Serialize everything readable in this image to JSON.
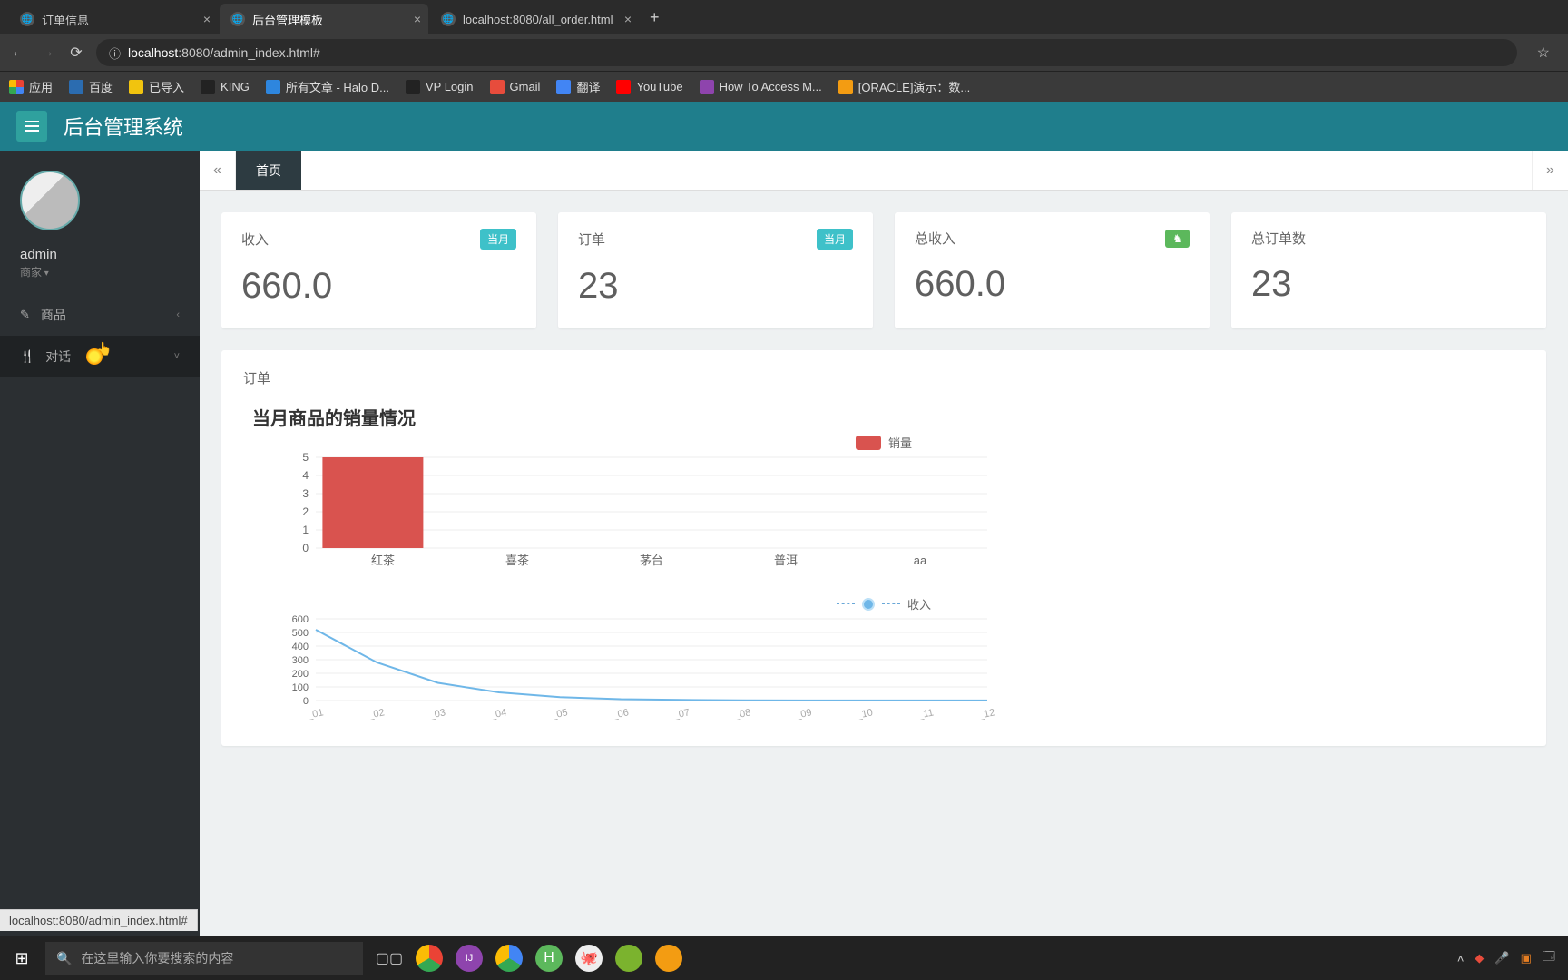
{
  "browser": {
    "tabs": [
      {
        "title": "订单信息"
      },
      {
        "title": "后台管理模板"
      },
      {
        "title": "localhost:8080/all_order.html"
      }
    ],
    "url_prefix": "localhost",
    "url_suffix": ":8080/admin_index.html#",
    "bookmarks": [
      {
        "label": "应用",
        "color": "#e74c3c"
      },
      {
        "label": "百度",
        "color": "#2b6cb0"
      },
      {
        "label": "已导入",
        "color": "#f1c40f"
      },
      {
        "label": "KING",
        "color": "#222"
      },
      {
        "label": "所有文章 - Halo D...",
        "color": "#2e86de"
      },
      {
        "label": "VP Login",
        "color": "#222"
      },
      {
        "label": "Gmail",
        "color": "#e74c3c"
      },
      {
        "label": "翻译",
        "color": "#4285f4"
      },
      {
        "label": "YouTube",
        "color": "#ff0000"
      },
      {
        "label": "How To Access M...",
        "color": "#8e44ad"
      },
      {
        "label": "[ORACLE]演示：数...",
        "color": "#f39c12"
      }
    ]
  },
  "app": {
    "title": "后台管理系统",
    "user": {
      "name": "admin",
      "role": "商家"
    },
    "nav": [
      {
        "icon": "✎",
        "label": "商品",
        "arrow": "‹"
      },
      {
        "icon": "🍴",
        "label": "对话",
        "arrow": "˅"
      }
    ],
    "page_tab": "首页",
    "cards": [
      {
        "label": "收入",
        "badge": "当月",
        "badge_cls": "teal",
        "value": "660.0"
      },
      {
        "label": "订单",
        "badge": "当月",
        "badge_cls": "teal",
        "value": "23"
      },
      {
        "label": "总收入",
        "badge": "♞",
        "badge_cls": "green",
        "value": "660.0"
      },
      {
        "label": "总订单数",
        "badge": "",
        "badge_cls": "",
        "value": "23"
      }
    ],
    "panel_title": "订单"
  },
  "chart_data": [
    {
      "type": "bar",
      "title": "当月商品的销量情况",
      "legend": "销量",
      "categories": [
        "红茶",
        "喜茶",
        "茅台",
        "普洱",
        "aa"
      ],
      "values": [
        5,
        0,
        0,
        0,
        0
      ],
      "ylim": [
        0,
        5
      ],
      "yticks": [
        0,
        1,
        2,
        3,
        4,
        5
      ],
      "bar_color": "#d9534f"
    },
    {
      "type": "line",
      "legend": "收入",
      "x": [
        "_01",
        "_02",
        "_03",
        "_04",
        "_05",
        "_06",
        "_07",
        "_08",
        "_09",
        "_10",
        "_11",
        "_12"
      ],
      "values": [
        520,
        280,
        130,
        60,
        25,
        10,
        5,
        2,
        1,
        1,
        1,
        1
      ],
      "ylim": [
        0,
        600
      ],
      "yticks": [
        0,
        100,
        200,
        300,
        400,
        500,
        600
      ],
      "line_color": "#6fb7e8"
    }
  ],
  "status": "localhost:8080/admin_index.html#",
  "taskbar": {
    "search_placeholder": "在这里输入你要搜索的内容"
  }
}
